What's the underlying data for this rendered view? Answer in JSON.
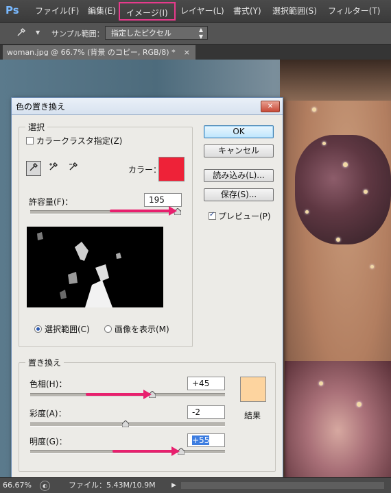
{
  "app": {
    "logo": "Ps"
  },
  "menu": {
    "items": [
      "ファイル(F)",
      "編集(E)",
      "イメージ(I)",
      "レイヤー(L)",
      "書式(Y)",
      "選択範囲(S)",
      "フィルター(T)"
    ],
    "active_index": 2
  },
  "options_bar": {
    "tool_icon": "eyedropper-icon",
    "sample_label": "サンプル範囲：",
    "sample_value": "指定したピクセル"
  },
  "document_tab": {
    "title": "woman.jpg @ 66.7% (背景 のコピー, RGB/8) *",
    "close": "×"
  },
  "dialog": {
    "title": "色の置き換え",
    "close": "✕",
    "selection_group": {
      "title": "選択",
      "localized_color_clusters": {
        "label": "カラークラスタ指定(Z)",
        "checked": false
      },
      "color_label": "カラー：",
      "color_value": "#ee2238",
      "tools": [
        "eyedropper-icon",
        "eyedropper-plus-icon",
        "eyedropper-minus-icon"
      ],
      "fuzziness": {
        "label": "許容量(F)：",
        "value": "195",
        "slider_fraction": 0.975
      },
      "view_options": [
        {
          "label": "選択範囲(C)",
          "checked": true
        },
        {
          "label": "画像を表示(M)",
          "checked": false
        }
      ]
    },
    "replacement_group": {
      "title": "置き換え",
      "hue": {
        "label": "色相(H)：",
        "value": "+45",
        "slider_fraction": 0.625
      },
      "saturation": {
        "label": "彩度(A)：",
        "value": "-2",
        "slider_fraction": 0.49
      },
      "lightness": {
        "label": "明度(G)：",
        "value": "+55",
        "slider_fraction": 0.775
      },
      "result_label": "結果",
      "result_color": "#fdd49f"
    },
    "buttons": {
      "ok": "OK",
      "cancel": "キャンセル",
      "load": "読み込み(L)...",
      "save": "保存(S)..."
    },
    "preview_checkbox": {
      "label": "プレビュー(P)",
      "checked": true
    }
  },
  "status_bar": {
    "zoom": "66.67%",
    "file_info": "ファイル：5.43M/10.9M"
  },
  "colors": {
    "accent_annotation": "#e8206e",
    "active_menu_border": "#e83a8c"
  }
}
